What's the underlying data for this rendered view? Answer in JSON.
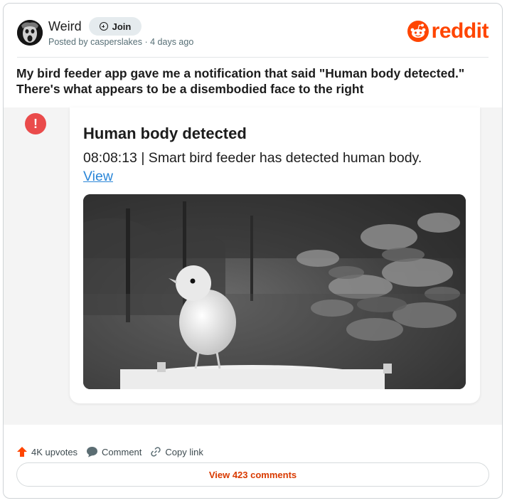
{
  "post": {
    "subreddit": "Weird",
    "join_label": "Join",
    "meta": "Posted by casperslakes · 4 days ago",
    "title": "My bird feeder app gave me a notification that said \"Human body detected.\" There's what appears to be a disembodied face to the right"
  },
  "brand": {
    "wordmark": "reddit",
    "color": "#ff4500"
  },
  "notification": {
    "alert_symbol": "!",
    "alert_color": "#ea4b4b",
    "title": "Human body detected",
    "body": "08:08:13 | Smart bird feeder has detected human body.",
    "link": "View"
  },
  "actions": {
    "upvotes": "4K upvotes",
    "comment": "Comment",
    "copy_link": "Copy link"
  },
  "footer": {
    "view_comments": "View 423 comments"
  },
  "icons": [
    "join-plus-icon",
    "reddit-snoo-icon",
    "alert-icon",
    "upvote-icon",
    "comment-bubble-icon",
    "link-icon"
  ]
}
